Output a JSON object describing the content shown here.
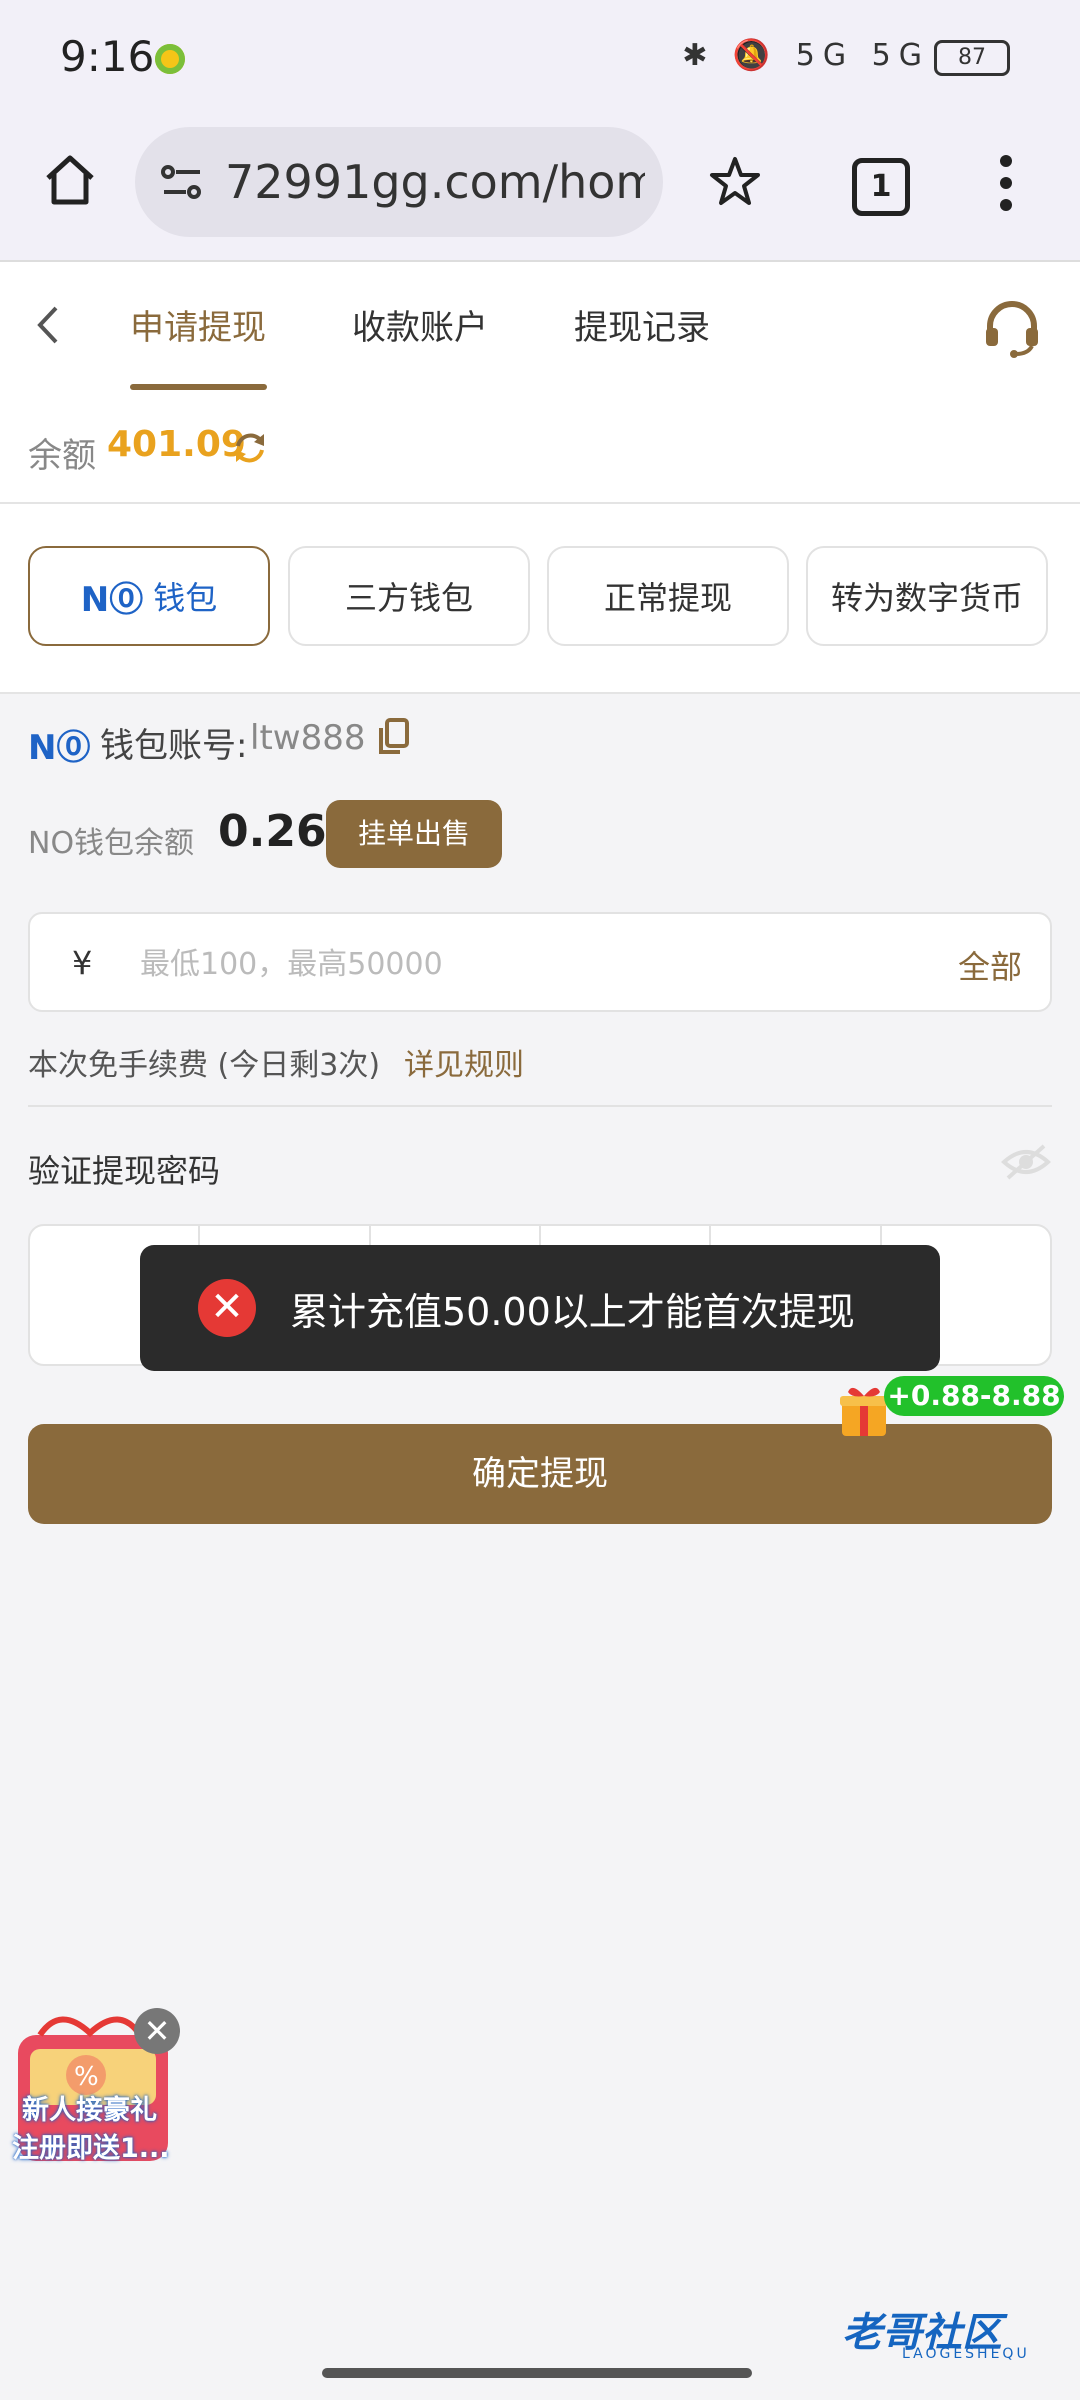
{
  "status_bar": {
    "time": "9:16",
    "icons": "✱ 🔕 5G 5G",
    "battery": "87"
  },
  "browser": {
    "url": "72991gg.com/home/w",
    "tab_count": "1"
  },
  "header": {
    "tabs": [
      {
        "label": "申请提现",
        "active": true
      },
      {
        "label": "收款账户",
        "active": false
      },
      {
        "label": "提现记录",
        "active": false
      }
    ]
  },
  "balance": {
    "label": "余额",
    "value": "401.09"
  },
  "methods": [
    {
      "logo": "N⓪",
      "label": "钱包",
      "active": true
    },
    {
      "label": "三方钱包",
      "active": false
    },
    {
      "label": "正常提现",
      "active": false
    },
    {
      "label": "转为数字货币",
      "active": false
    }
  ],
  "wallet": {
    "logo": "N⓪",
    "account_label": "钱包账号:",
    "account": "ltw888",
    "balance_label": "NO钱包余额",
    "balance": "0.26",
    "sell_label": "挂单出售"
  },
  "amount": {
    "currency": "¥",
    "placeholder": "最低100，最高50000",
    "all_label": "全部"
  },
  "fee": {
    "note": "本次免手续费 (今日剩3次)",
    "link": "详见规则"
  },
  "verify": {
    "label": "验证提现密码"
  },
  "toast": {
    "icon": "✕",
    "message": "累计充值50.00以上才能首次提现"
  },
  "confirm_label": "确定提现",
  "bonus": {
    "label": "+0.88-8.88"
  },
  "promo": {
    "line1": "新人接豪礼",
    "line2": "注册即送1...",
    "close": "✕"
  },
  "watermark": {
    "text": "老哥社区",
    "sub": "LAOGESHEQU"
  },
  "colors": {
    "accent": "#8a6a3c",
    "balance": "#e9a21e",
    "brand_blue": "#1e63c6",
    "error": "#e53935",
    "bonus": "#22c12b"
  }
}
